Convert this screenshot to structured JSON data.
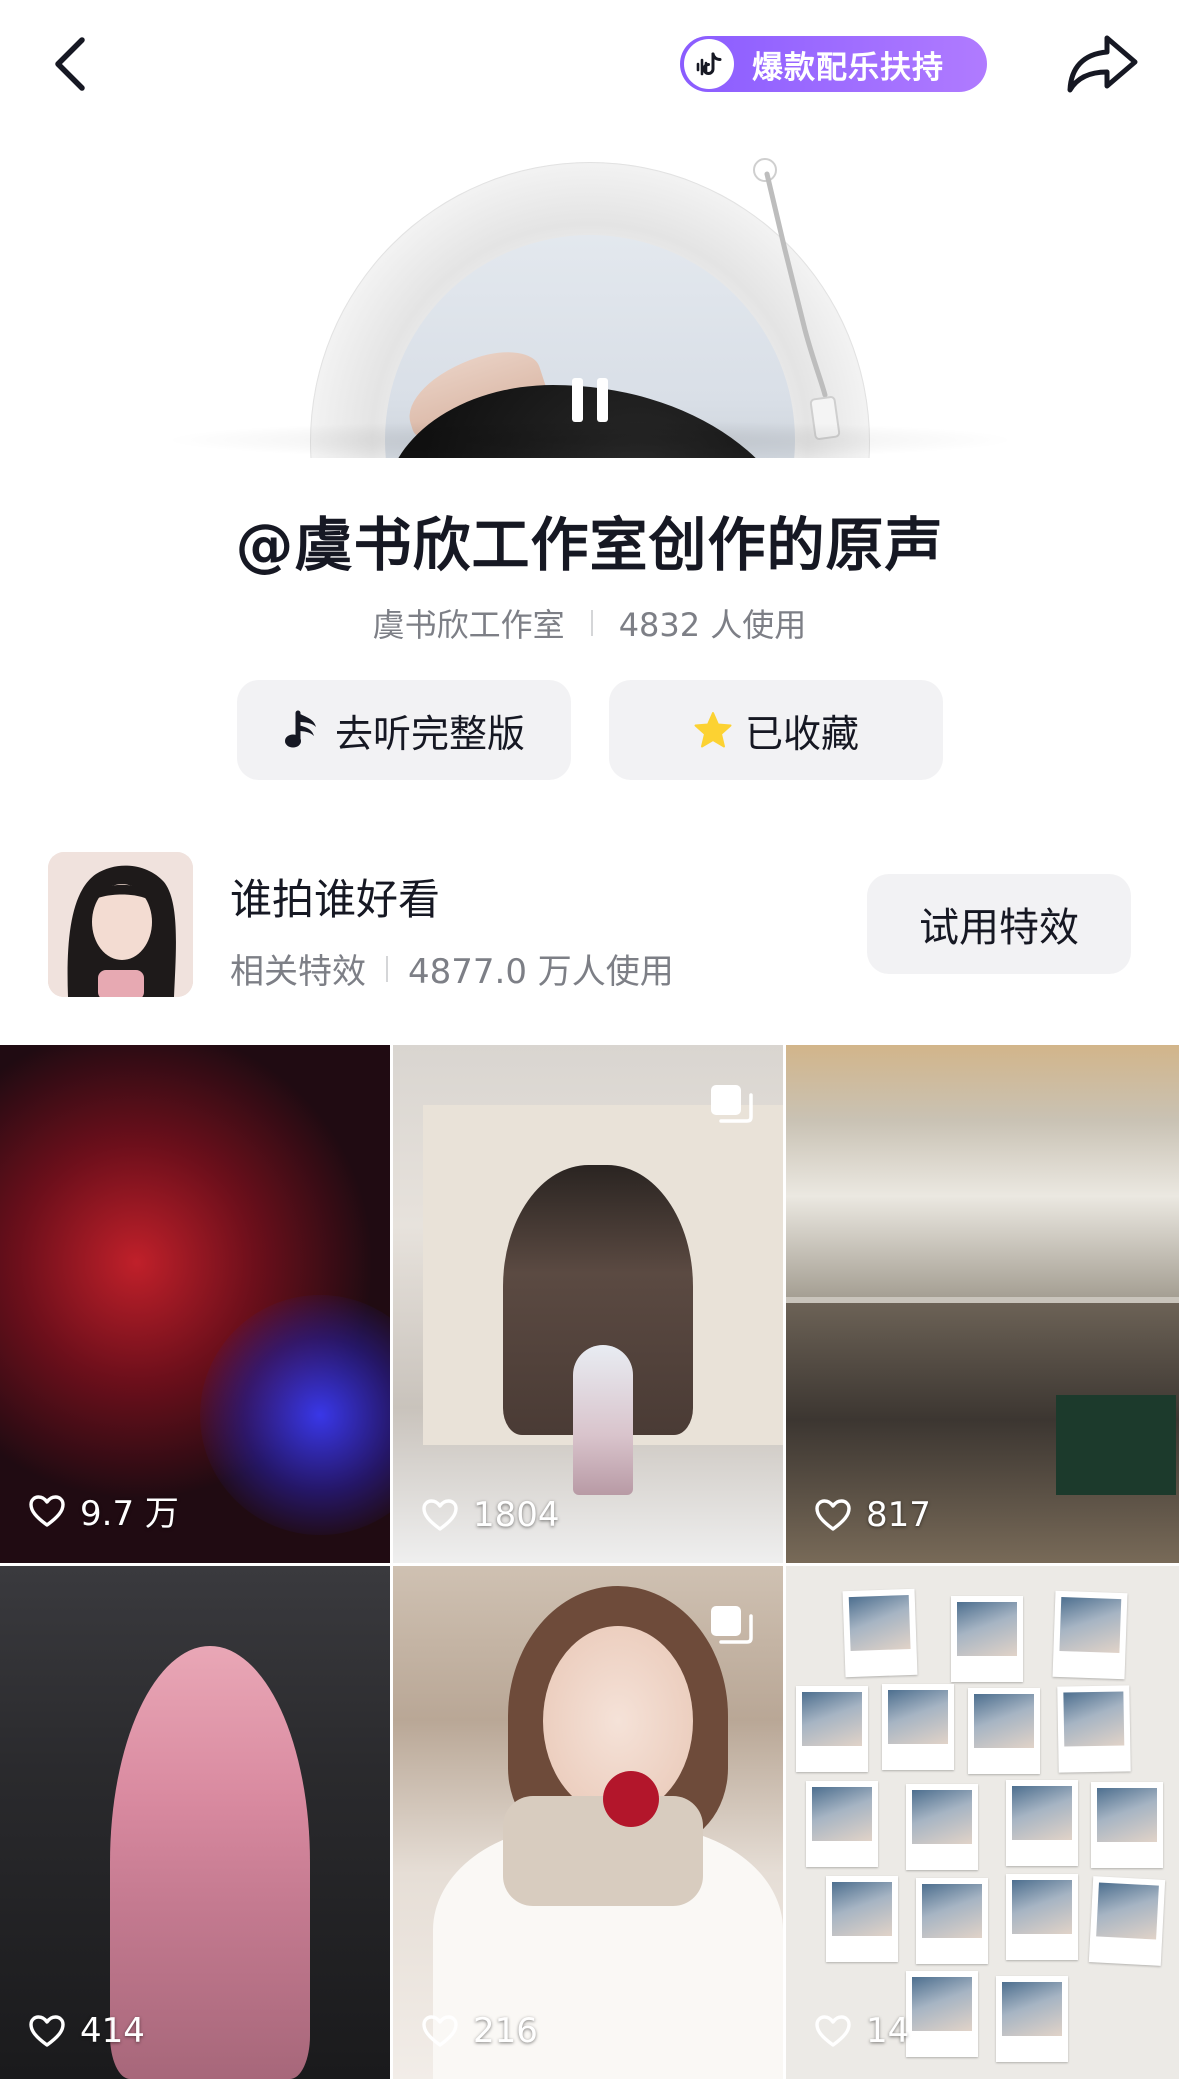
{
  "topbar": {
    "promo_badge": "爆款配乐扶持",
    "back_icon": "chevron-left-icon",
    "share_icon": "share-arrow-icon"
  },
  "song": {
    "title": "@虞书欣工作室创作的原声",
    "author": "虞书欣工作室",
    "usage": "4832 人使用"
  },
  "actions": {
    "listen_full": "去听完整版",
    "favorited": "已收藏"
  },
  "effect": {
    "name": "谁拍谁好看",
    "tag": "相关特效",
    "usage": "4877.0 万人使用",
    "try_button": "试用特效"
  },
  "videos": [
    {
      "likes": "9.7 万",
      "multi_image": false
    },
    {
      "likes": "1804",
      "multi_image": true
    },
    {
      "likes": "817",
      "multi_image": false
    },
    {
      "likes": "414",
      "multi_image": false
    },
    {
      "likes": "216",
      "multi_image": true
    },
    {
      "likes": "14",
      "multi_image": false
    }
  ],
  "colors": {
    "promo_gradient_start": "#8a5cff",
    "promo_gradient_end": "#b07bff",
    "star": "#fcd232",
    "button_bg": "#f2f2f4",
    "secondary_text": "#7d7f86"
  }
}
